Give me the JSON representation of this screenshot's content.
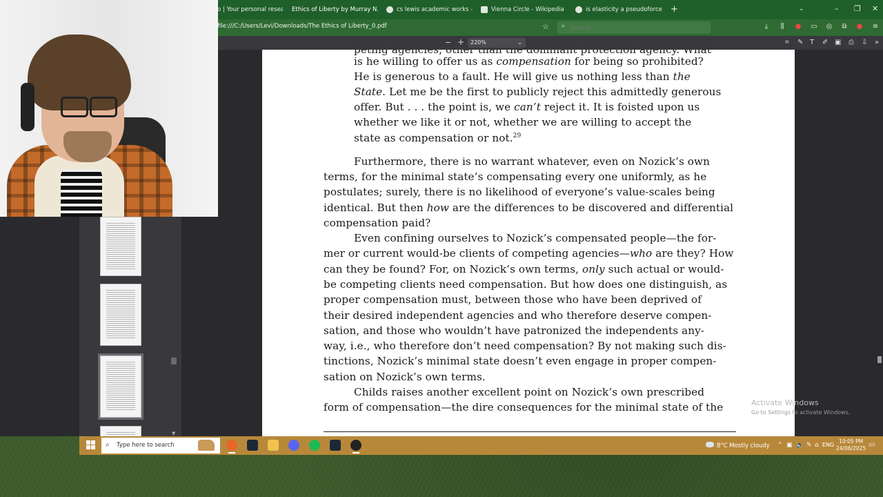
{
  "browser": {
    "tabs": [
      {
        "label": "o | Your personal research"
      },
      {
        "label": "Ethics of Liberty by Murray N. Rothb"
      },
      {
        "label": "cs lewis academic works - Goo"
      },
      {
        "label": "Vienna Circle - Wikipedia"
      },
      {
        "label": "is elasticity a pseudoforce - Goo"
      }
    ],
    "new_tab": "+",
    "url": "file:///C:/Users/Levi/Downloads/The Ethics of Liberty_0.pdf",
    "search_placeholder": "Search"
  },
  "pdf_toolbar": {
    "zoom_out": "−",
    "zoom_in": "+",
    "zoom_value": "220%"
  },
  "document": {
    "lines": [
      {
        "t": "peting agencies, other than the dominant protection agency. What"
      },
      {
        "t": "is he willing to offer us as ",
        "i": "compensation",
        "t2": " for being so prohibited?"
      },
      {
        "t": "He is generous to a fault. He will give us nothing less than ",
        "i": "the"
      },
      {
        "i": "State",
        "t2": ". Let me be the first to publicly reject this admittedly generous"
      },
      {
        "t": "offer. But . . . the point is, we ",
        "i": "can’t",
        "t2": " reject it. It is foisted upon us"
      },
      {
        "t": "whether we like it or not, whether we are willing to accept the"
      },
      {
        "t": "state as compensation or not.",
        "sup": "29"
      },
      {
        "t": "Furthermore, there is no warrant whatever, even on Nozick’s own"
      },
      {
        "t": "terms, for the minimal state’s compensating every one uniformly, as he"
      },
      {
        "t": "postulates; surely, there is no likelihood of everyone’s value-scales being"
      },
      {
        "t": "identical. But then ",
        "i": "how",
        "t2": " are the differences to be discovered and differential"
      },
      {
        "t": "compensation paid?"
      },
      {
        "t": "Even confining ourselves to Nozick’s compensated people—the for-"
      },
      {
        "t": "mer or current would-be clients of competing agencies—",
        "i": "who",
        "t2": " are they? How"
      },
      {
        "t": "can they be found? For, on Nozick’s own terms, ",
        "i": "only",
        "t2": " such actual or would-"
      },
      {
        "t": "be competing clients need compensation. But how does one distinguish, as"
      },
      {
        "t": "proper compensation must, between those who have been deprived of"
      },
      {
        "t": "their desired independent agencies and who therefore deserve compen-"
      },
      {
        "t": "sation, and those who wouldn’t have patronized the independents any-"
      },
      {
        "t": "way, i.e., who therefore don’t need compensation? By not making such dis-"
      },
      {
        "t": "tinctions, Nozick’s minimal state doesn’t even engage in proper compen-"
      },
      {
        "t": "sation on Nozick’s own terms."
      },
      {
        "t": "Childs raises another excellent point on Nozick’s own prescribed"
      },
      {
        "t": "form of compensation—the dire consequences for the minimal state of the"
      }
    ]
  },
  "watermark": {
    "title": "Activate Windows",
    "subtitle": "Go to Settings to activate Windows."
  },
  "taskbar": {
    "search_placeholder": "Type here to search",
    "weather": "8°C  Mostly cloudy",
    "language": "ENG",
    "time": "10:05 PM",
    "date": "24/06/2025"
  },
  "colors": {
    "tabbar": "#1f5f2a",
    "toolbar": "#2f6a33",
    "taskbar": "#b8883a",
    "pdf_bg": "#2a2a2e"
  }
}
